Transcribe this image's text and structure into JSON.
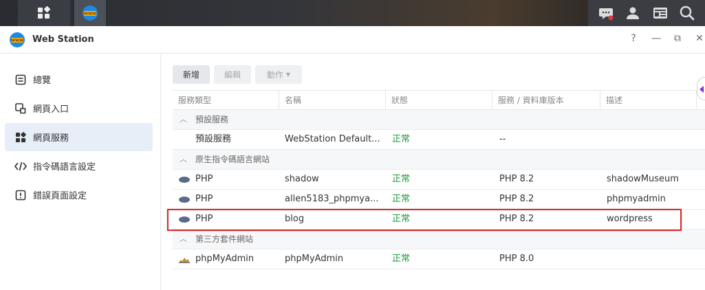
{
  "app": {
    "title": "Web Station",
    "logo_icon": "web-station-logo",
    "window_controls": {
      "help": "?",
      "minimize": "—",
      "restore": "⧉",
      "close": "✕"
    }
  },
  "taskbar": {
    "left_icons": [
      "main-menu-icon",
      "web-station-logo"
    ],
    "right_icons": [
      "notification-icon",
      "user-icon",
      "widgets-icon",
      "search-icon"
    ]
  },
  "sidebar": {
    "items": [
      {
        "label": "總覽",
        "icon": "overview-icon",
        "active": false
      },
      {
        "label": "網頁入口",
        "icon": "web-portal-icon",
        "active": false
      },
      {
        "label": "網頁服務",
        "icon": "web-service-icon",
        "active": true
      },
      {
        "label": "指令碼語言設定",
        "icon": "code-icon",
        "active": false
      },
      {
        "label": "錯誤頁面設定",
        "icon": "error-page-icon",
        "active": false
      }
    ]
  },
  "toolbar": {
    "add_label": "新增",
    "edit_label": "編輯",
    "action_label": "動作"
  },
  "table": {
    "columns": [
      "服務類型",
      "名稱",
      "狀態",
      "服務 / 資料庫版本",
      "描述"
    ],
    "groups": [
      {
        "label": "預設服務",
        "rows": [
          {
            "type": "預設服務",
            "name": "WebStation Default...",
            "status": "正常",
            "version": "--",
            "description": ""
          }
        ]
      },
      {
        "label": "原生指令碼語言網站",
        "rows": [
          {
            "type": "PHP",
            "name": "shadow",
            "status": "正常",
            "version": "PHP 8.2",
            "description": "shadowMuseum"
          },
          {
            "type": "PHP",
            "name": "allen5183_phpmya...",
            "status": "正常",
            "version": "PHP 8.2",
            "description": "phpmyadmin"
          },
          {
            "type": "PHP",
            "name": "blog",
            "status": "正常",
            "version": "PHP 8.2",
            "description": "wordpress"
          }
        ]
      },
      {
        "label": "第三方套件網站",
        "rows": [
          {
            "type": "phpMyAdmin",
            "name": "phpMyAdmin",
            "status": "正常",
            "version": "PHP 8.0",
            "description": ""
          }
        ]
      }
    ]
  },
  "colors": {
    "accent": "#e7eef8",
    "status_ok": "#1a9a3c",
    "highlight": "#d52b2b"
  }
}
